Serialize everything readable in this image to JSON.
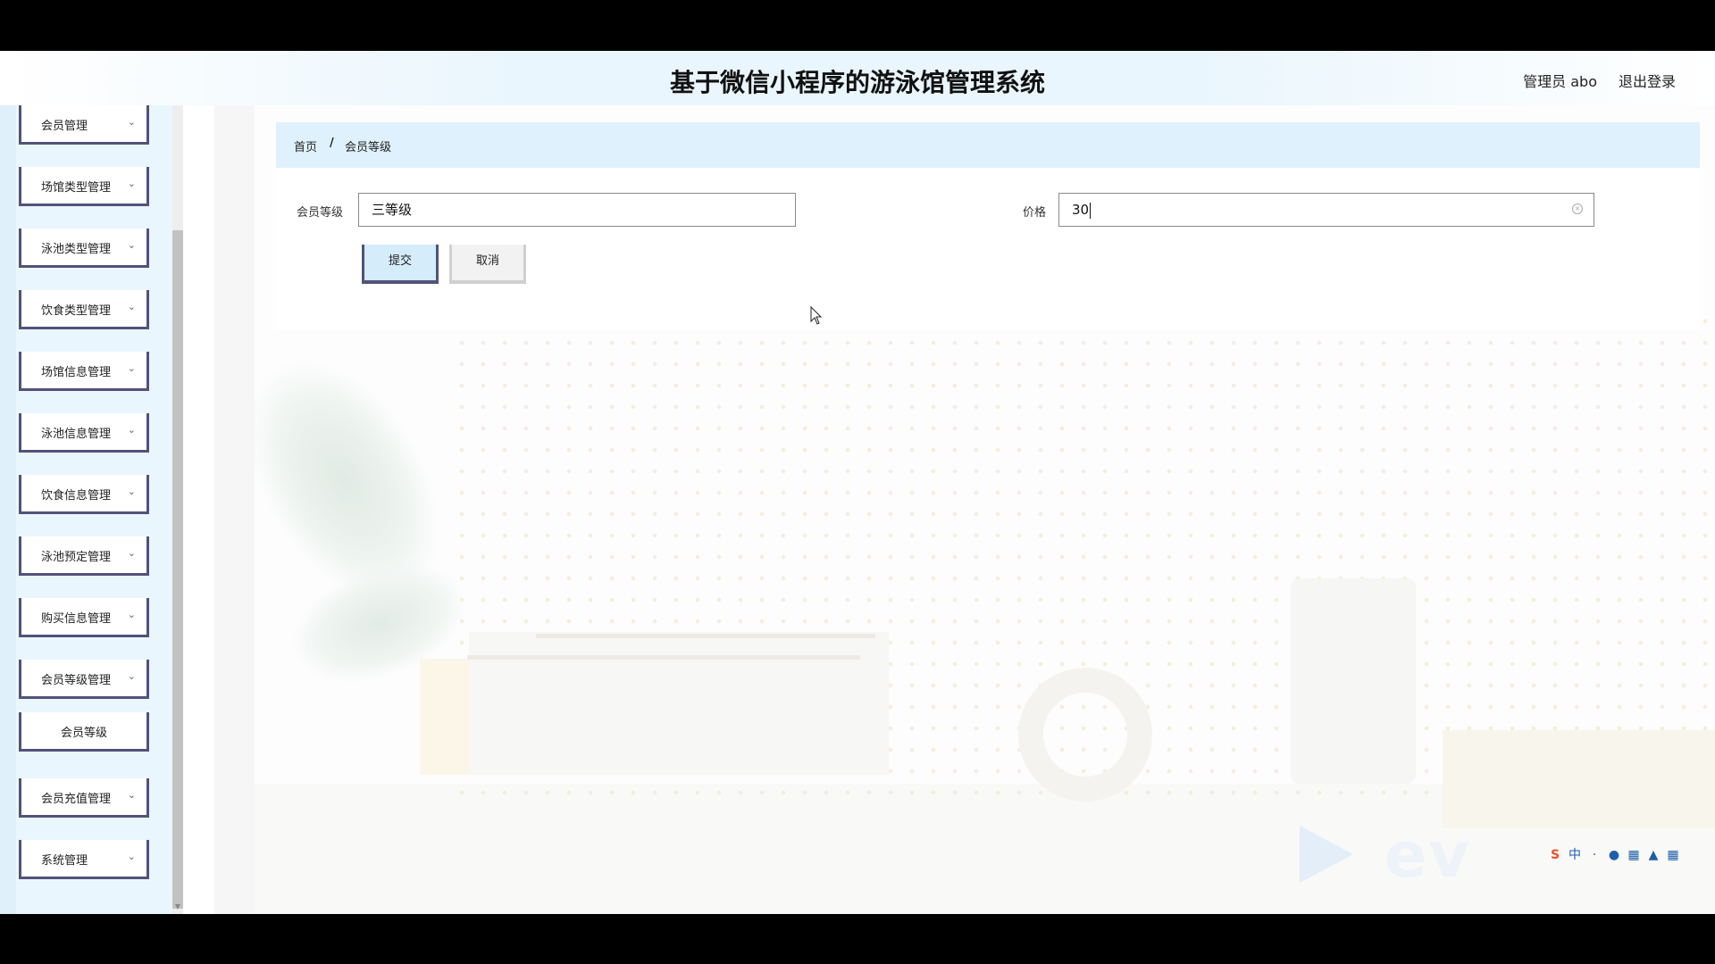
{
  "header": {
    "title": "基于微信小程序的游泳馆管理系统",
    "admin": "管理员 abo",
    "logout": "退出登录"
  },
  "sidebar": {
    "items": [
      {
        "label": "会员管理"
      },
      {
        "label": "场馆类型管理"
      },
      {
        "label": "泳池类型管理"
      },
      {
        "label": "饮食类型管理"
      },
      {
        "label": "场馆信息管理"
      },
      {
        "label": "泳池信息管理"
      },
      {
        "label": "饮食信息管理"
      },
      {
        "label": "泳池预定管理"
      },
      {
        "label": "购买信息管理"
      },
      {
        "label": "会员等级管理"
      },
      {
        "label": "会员等级"
      },
      {
        "label": "会员充值管理"
      },
      {
        "label": "系统管理"
      }
    ]
  },
  "breadcrumb": {
    "home": "首页",
    "separator": "/",
    "current": "会员等级"
  },
  "form": {
    "level_label": "会员等级",
    "level_value": "三等级",
    "price_label": "价格",
    "price_value": "30",
    "submit": "提交",
    "cancel": "取消"
  },
  "overlay": {
    "watermark": "ev"
  },
  "colors": {
    "accent": "#dff1fc",
    "border": "#52527a"
  }
}
